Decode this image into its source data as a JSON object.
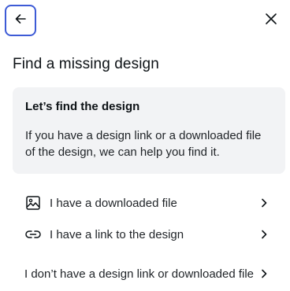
{
  "header": {
    "back_icon": "arrow-left-icon",
    "close_icon": "close-icon"
  },
  "title": "Find a missing design",
  "info": {
    "heading": "Let’s find the design",
    "body": "If you have a design link or a downloaded file of the design, we can help you find it."
  },
  "options": [
    {
      "icon": "image-icon",
      "label": "I have a downloaded file"
    },
    {
      "icon": "link-icon",
      "label": "I have a link to the design"
    },
    {
      "label": "I don’t have a design link or downloaded file"
    }
  ],
  "colors": {
    "focus_border": "#3d5bd6",
    "card_bg": "#f2f3f5"
  }
}
